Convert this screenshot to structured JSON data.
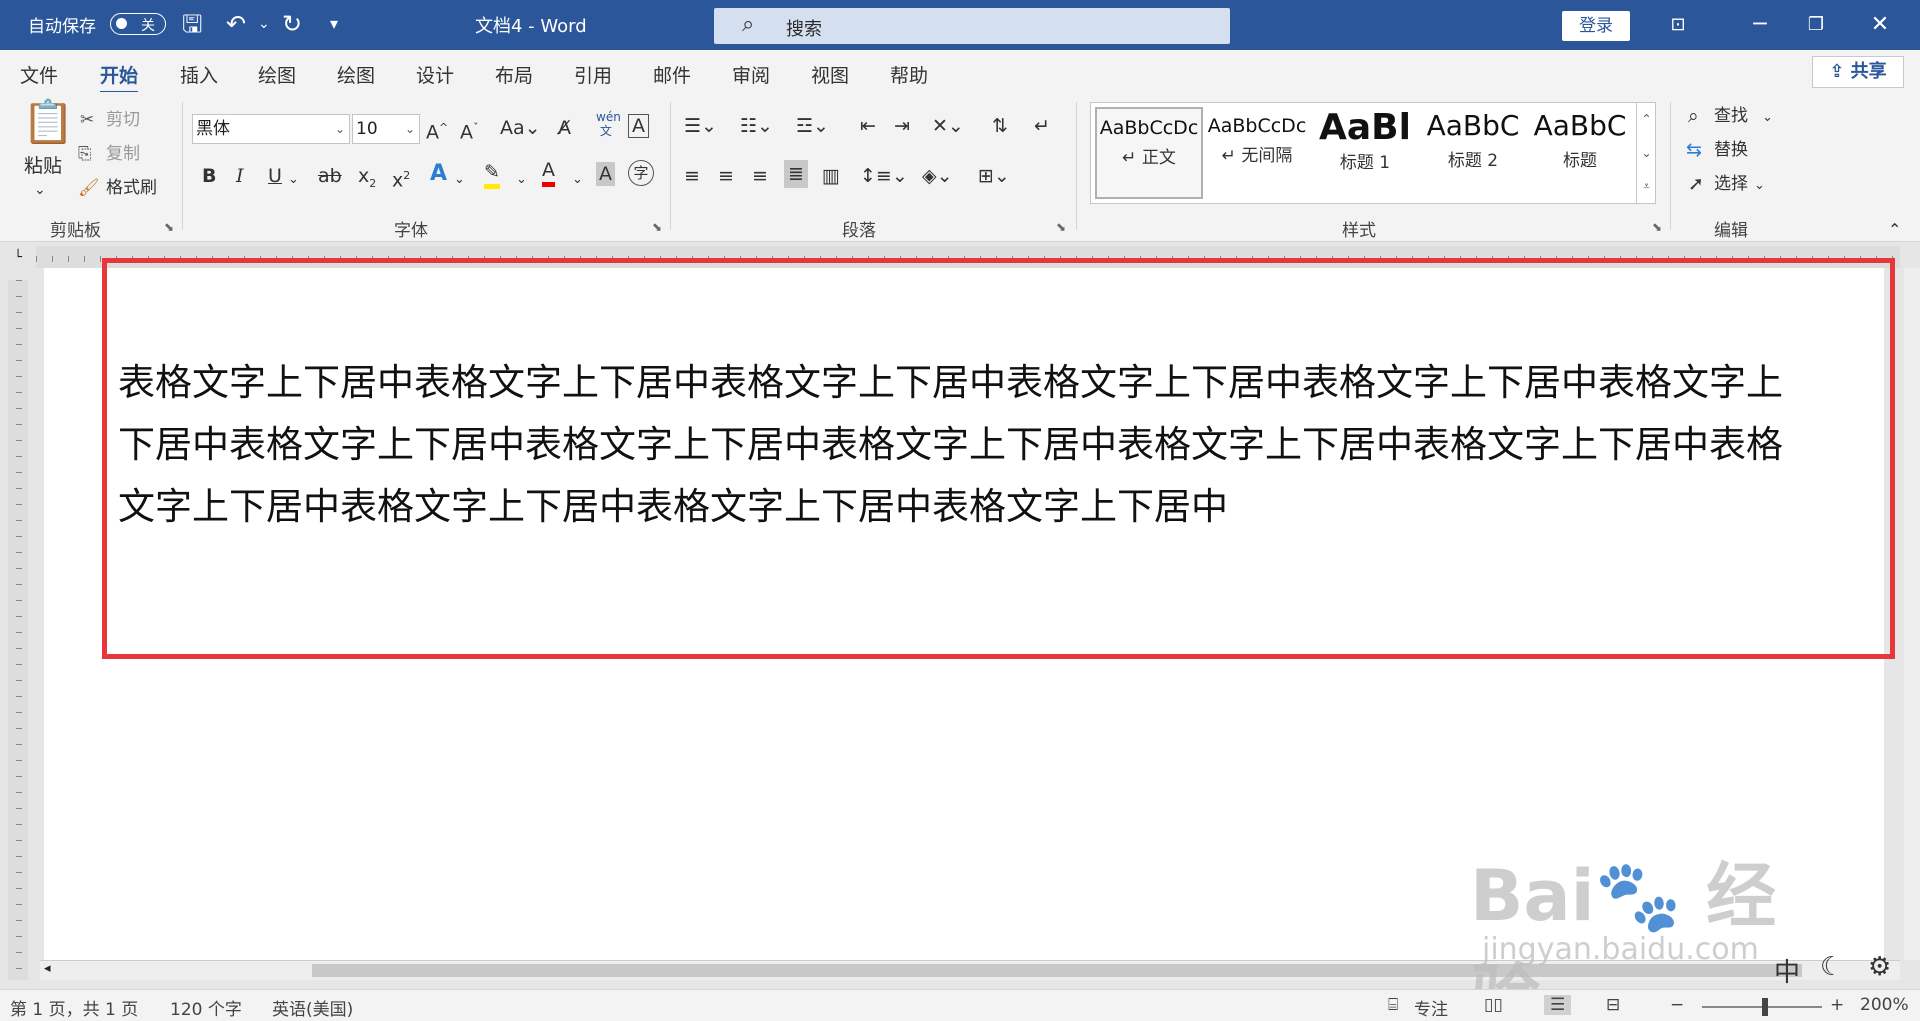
{
  "titlebar": {
    "autosave_label": "自动保存",
    "autosave_state": "关",
    "doc_title": "文档4 - Word",
    "search_placeholder": "搜索",
    "login_label": "登录"
  },
  "tabs": [
    "文件",
    "开始",
    "插入",
    "绘图",
    "绘图",
    "设计",
    "布局",
    "引用",
    "邮件",
    "审阅",
    "视图",
    "帮助"
  ],
  "active_tab": "开始",
  "share_label": "共享",
  "clipboard": {
    "paste": "粘贴",
    "cut": "剪切",
    "copy": "复制",
    "format_painter": "格式刷",
    "group": "剪贴板"
  },
  "font": {
    "name": "黑体",
    "size": "10",
    "group": "字体"
  },
  "paragraph": {
    "group": "段落"
  },
  "styles": {
    "group": "样式",
    "items": [
      {
        "preview": "AaBbCcDc",
        "name": "↵ 正文"
      },
      {
        "preview": "AaBbCcDc",
        "name": "↵ 无间隔"
      },
      {
        "preview": "AaBl",
        "name": "标题 1"
      },
      {
        "preview": "AaBbC",
        "name": "标题 2"
      },
      {
        "preview": "AaBbC",
        "name": "标题"
      }
    ]
  },
  "editing": {
    "find": "查找",
    "replace": "替换",
    "select": "选择",
    "group": "编辑"
  },
  "document": {
    "text": "表格文字上下居中表格文字上下居中表格文字上下居中表格文字上下居中表格文字上下居中表格文字上下居中表格文字上下居中表格文字上下居中表格文字上下居中表格文字上下居中表格文字上下居中表格文字上下居中表格文字上下居中表格文字上下居中表格文字上下居中"
  },
  "status": {
    "page": "第 1 页，共 1 页",
    "words": "120 个字",
    "language": "英语(美国)",
    "focus": "专注",
    "zoom": "200%"
  },
  "watermark": {
    "logo": "Bai du 经验",
    "url": "jingyan.baidu.com"
  },
  "colors": {
    "accent": "#2b579a",
    "highlight_box": "#e8373c"
  }
}
